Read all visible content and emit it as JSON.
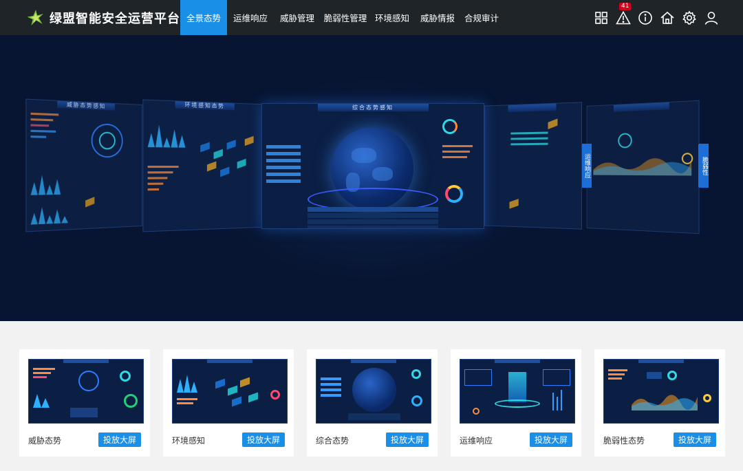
{
  "brand": {
    "title": "绿盟智能安全运营平台"
  },
  "nav": [
    {
      "label": "全景态势",
      "active": true
    },
    {
      "label": "运维响应",
      "active": false
    },
    {
      "label": "威胁管理",
      "active": false
    },
    {
      "label": "脆弱性管理",
      "active": false
    },
    {
      "label": "环境感知",
      "active": false
    },
    {
      "label": "威胁情报",
      "active": false
    },
    {
      "label": "合规审计",
      "active": false
    }
  ],
  "header_tools": {
    "alert_count": "41",
    "icons": [
      "grid-icon",
      "alert-icon",
      "info-icon",
      "home-icon",
      "gear-icon",
      "user-icon"
    ]
  },
  "hero": {
    "center_screen_title": "综合态势感知",
    "left_screen_title": "环境感知态势",
    "far_left_screen_title": "威胁态势感知",
    "right_tab_ops": "运维响应",
    "right_tab_vuln": "脆弱性"
  },
  "cards": [
    {
      "title": "威胁态势",
      "button": "投放大屏"
    },
    {
      "title": "环境感知",
      "button": "投放大屏"
    },
    {
      "title": "综合态势",
      "button": "投放大屏"
    },
    {
      "title": "运维响应",
      "button": "投放大屏"
    },
    {
      "title": "脆弱性态势",
      "button": "投放大屏"
    }
  ],
  "colors": {
    "header_bg": "#1f2428",
    "accent": "#1a8fe8",
    "hero_bg": "#071532",
    "badge": "#d0021b",
    "page_bg": "#f2f2f2"
  }
}
